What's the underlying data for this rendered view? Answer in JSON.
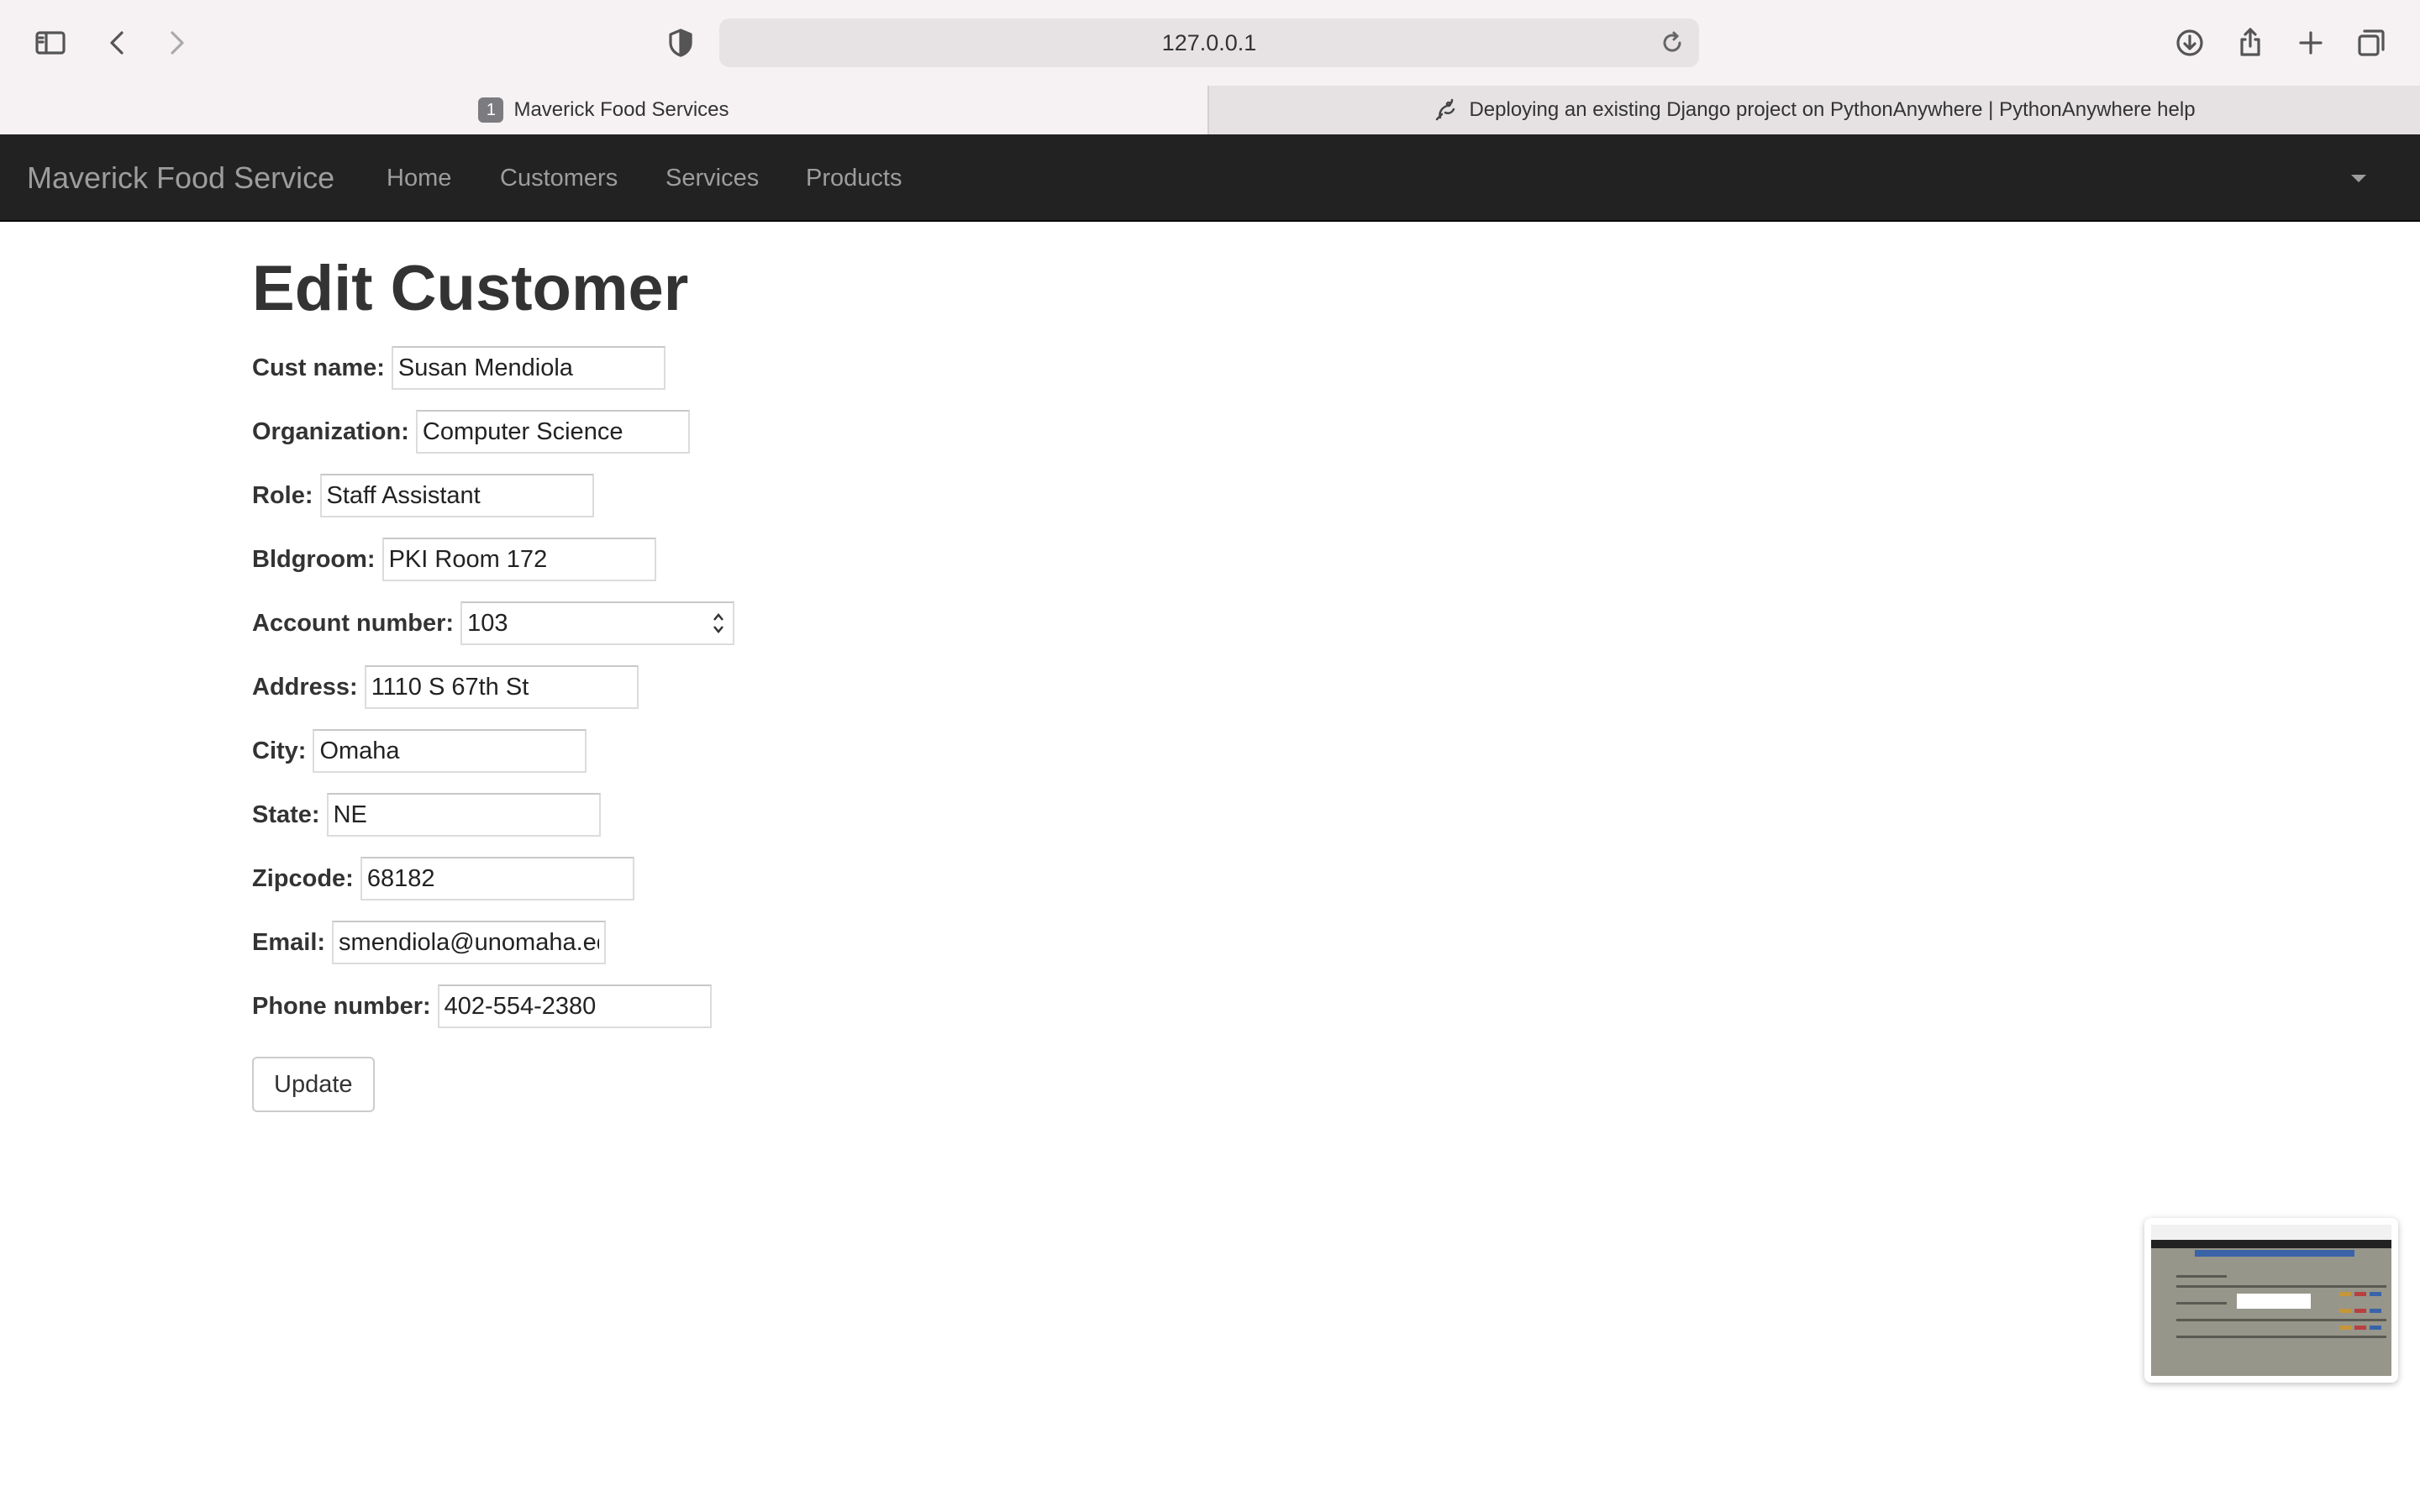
{
  "browser": {
    "url": "127.0.0.1",
    "tabs": [
      {
        "badge": "1",
        "title": "Maverick Food Services",
        "active": true
      },
      {
        "title": "Deploying an existing Django project on PythonAnywhere | PythonAnywhere help",
        "active": false
      }
    ]
  },
  "navbar": {
    "brand": "Maverick Food Service",
    "items": [
      "Home",
      "Customers",
      "Services",
      "Products"
    ]
  },
  "page": {
    "title": "Edit Customer",
    "fields": [
      {
        "label": "Cust name:",
        "value": "Susan Mendiola"
      },
      {
        "label": "Organization:",
        "value": "Computer Science"
      },
      {
        "label": "Role:",
        "value": "Staff Assistant"
      },
      {
        "label": "Bldgroom:",
        "value": "PKI Room 172"
      },
      {
        "label": "Account number:",
        "value": "103"
      },
      {
        "label": "Address:",
        "value": "1110 S 67th St"
      },
      {
        "label": "City:",
        "value": "Omaha"
      },
      {
        "label": "State:",
        "value": "NE"
      },
      {
        "label": "Zipcode:",
        "value": "68182"
      },
      {
        "label": "Email:",
        "value": "smendiola@unomaha.edu"
      },
      {
        "label": "Phone number:",
        "value": "402-554-2380"
      }
    ],
    "submit_label": "Update"
  },
  "colors": {
    "navbar_bg": "#222222",
    "navbar_text": "#9d9d9d",
    "toolbar_bg": "#f6f2f3"
  }
}
